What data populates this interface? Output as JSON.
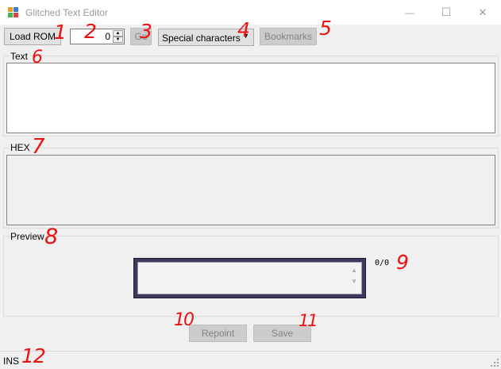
{
  "window": {
    "title": "Glitched Text Editor",
    "minimize_glyph": "—",
    "maximize_glyph": "☐",
    "close_glyph": "✕"
  },
  "toolbar": {
    "load_rom_label": "Load ROM",
    "offset_value": "0",
    "go_label": "Go",
    "special_characters_label": "Special characters",
    "bookmarks_label": "Bookmarks"
  },
  "groups": {
    "text_label": "Text",
    "hex_label": "HEX",
    "preview_label": "Preview"
  },
  "preview": {
    "page_counter": "0/0"
  },
  "actions": {
    "repoint_label": "Repoint",
    "save_label": "Save"
  },
  "status": {
    "mode": "INS"
  },
  "annotations": {
    "n1": "1",
    "n2": "2",
    "n3": "3",
    "n4": "4",
    "n5": "5",
    "n6": "6",
    "n7": "7",
    "n8": "8",
    "n9": "9",
    "n10": "10",
    "n11": "11",
    "n12": "12"
  },
  "colors": {
    "annotation": "#ee1111",
    "preview_frame": "#3b3a5a",
    "window_bg": "#f0f0f0"
  },
  "icons": {
    "app": "app-icon",
    "spin_up": "spin-up-icon",
    "spin_down": "spin-down-icon",
    "dropdown": "chevron-down-icon",
    "resize": "resize-grip-icon"
  }
}
